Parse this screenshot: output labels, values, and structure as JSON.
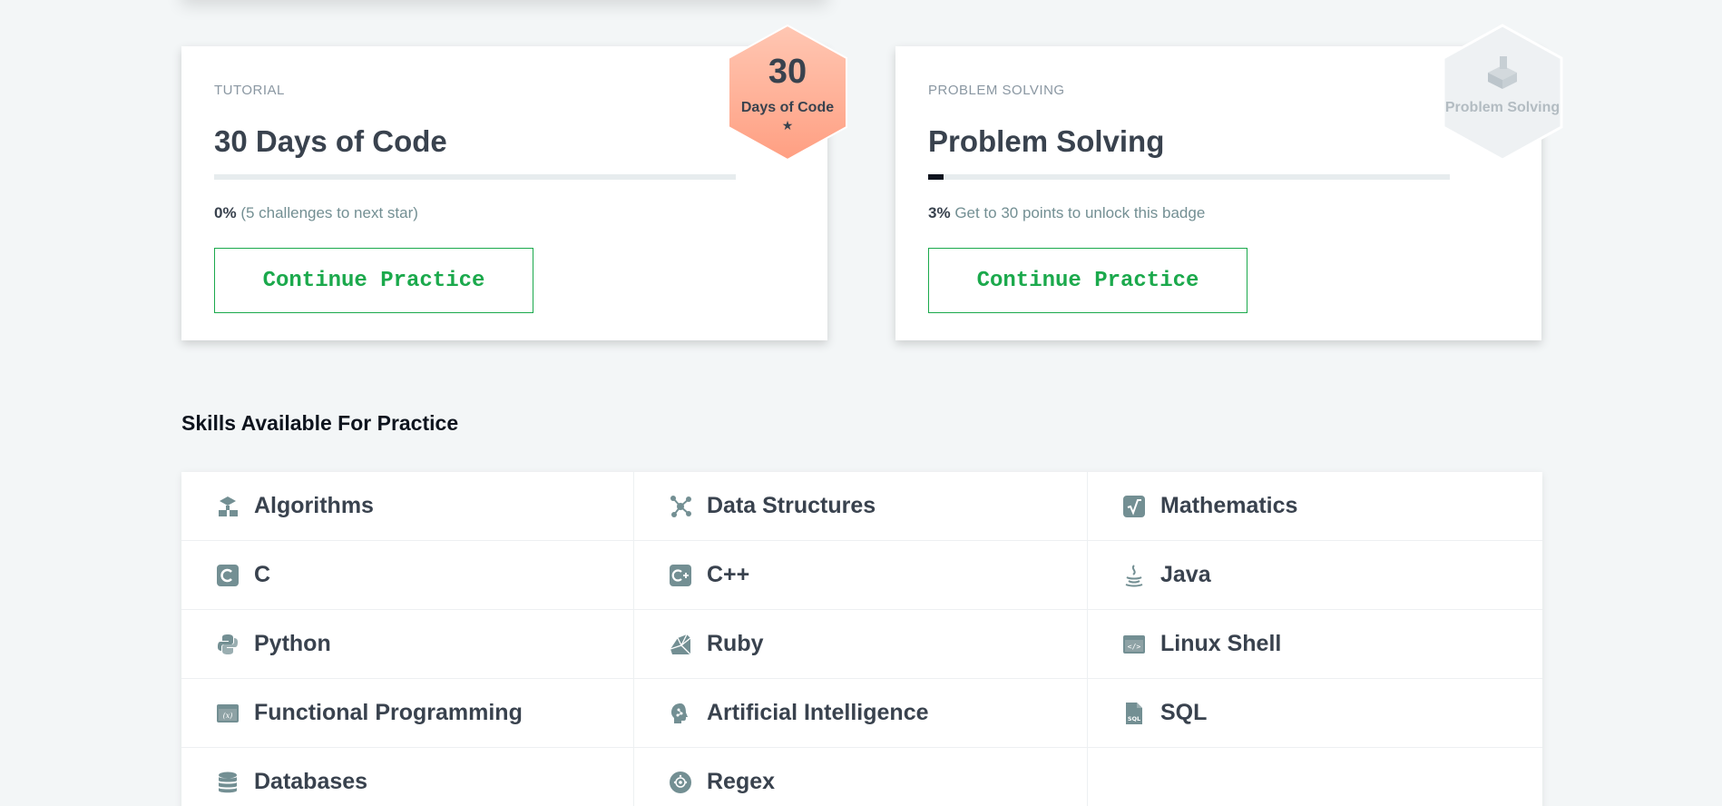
{
  "cards": [
    {
      "kicker": "TUTORIAL",
      "title": "30 Days of Code",
      "progress_pct": "0%",
      "progress_value": 0,
      "progress_note": "(5 challenges to next star)",
      "button_label": "Continue Practice",
      "badge": {
        "number": "30",
        "label": "Days of Code",
        "star": "★",
        "color": "#ffb39a"
      }
    },
    {
      "kicker": "PROBLEM SOLVING",
      "title": "Problem Solving",
      "progress_pct": "3%",
      "progress_value": 3,
      "progress_note": "Get to 30 points to unlock this badge",
      "button_label": "Continue Practice",
      "badge": {
        "label": "Problem Solving",
        "icon": "cube-icon",
        "color": "#eef1f3"
      }
    }
  ],
  "skills_section": {
    "title": "Skills Available For Practice",
    "skills": [
      {
        "label": "Algorithms",
        "icon": "algorithms-icon"
      },
      {
        "label": "Data Structures",
        "icon": "data-structures-icon"
      },
      {
        "label": "Mathematics",
        "icon": "sqrt-icon"
      },
      {
        "label": "C",
        "icon": "c-icon"
      },
      {
        "label": "C++",
        "icon": "cpp-icon"
      },
      {
        "label": "Java",
        "icon": "java-icon"
      },
      {
        "label": "Python",
        "icon": "python-icon"
      },
      {
        "label": "Ruby",
        "icon": "ruby-icon"
      },
      {
        "label": "Linux Shell",
        "icon": "terminal-icon"
      },
      {
        "label": "Functional Programming",
        "icon": "function-icon"
      },
      {
        "label": "Artificial Intelligence",
        "icon": "brain-icon"
      },
      {
        "label": "SQL",
        "icon": "sql-file-icon"
      },
      {
        "label": "Databases",
        "icon": "database-icon"
      },
      {
        "label": "Regex",
        "icon": "regex-icon"
      }
    ]
  },
  "colors": {
    "accent_green": "#1ba94c",
    "text_dark": "#39424e",
    "text_muted": "#738f93",
    "icon_gray": "#738f93",
    "background": "#f3f6f7"
  }
}
